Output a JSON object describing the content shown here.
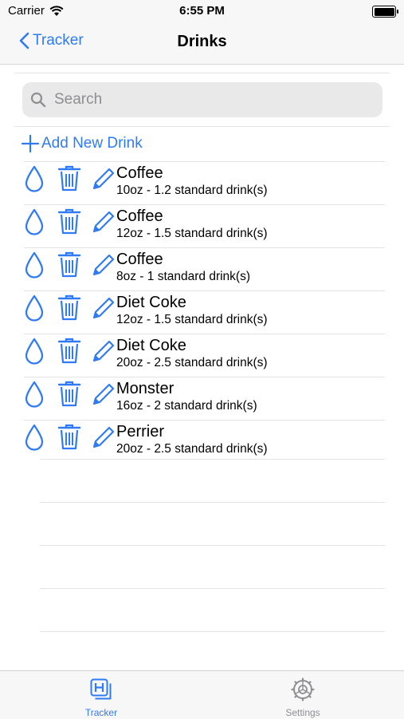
{
  "status_bar": {
    "carrier": "Carrier",
    "time": "6:55 PM"
  },
  "nav": {
    "back_label": "Tracker",
    "title": "Drinks"
  },
  "search": {
    "placeholder": "Search",
    "value": ""
  },
  "add_button_label": "Add New Drink",
  "drinks": [
    {
      "name": "Coffee",
      "detail": "10oz - 1.2 standard drink(s)"
    },
    {
      "name": "Coffee",
      "detail": "12oz - 1.5 standard drink(s)"
    },
    {
      "name": "Coffee",
      "detail": "8oz - 1 standard drink(s)"
    },
    {
      "name": "Diet Coke",
      "detail": "12oz - 1.5 standard drink(s)"
    },
    {
      "name": "Diet Coke",
      "detail": "20oz - 2.5 standard drink(s)"
    },
    {
      "name": "Monster",
      "detail": "16oz - 2 standard drink(s)"
    },
    {
      "name": "Perrier",
      "detail": "20oz - 2.5 standard drink(s)"
    }
  ],
  "row_icons": [
    "drop-icon",
    "trash-icon",
    "pencil-icon"
  ],
  "tab_bar": {
    "tabs": [
      {
        "label": "Tracker",
        "icon": "tracker-icon",
        "selected": true
      },
      {
        "label": "Settings",
        "icon": "gear-icon",
        "selected": false
      }
    ]
  },
  "colors": {
    "accent": "#2f7bf6",
    "inactive": "#8e8e93",
    "bar_background": "#f7f7f7"
  }
}
